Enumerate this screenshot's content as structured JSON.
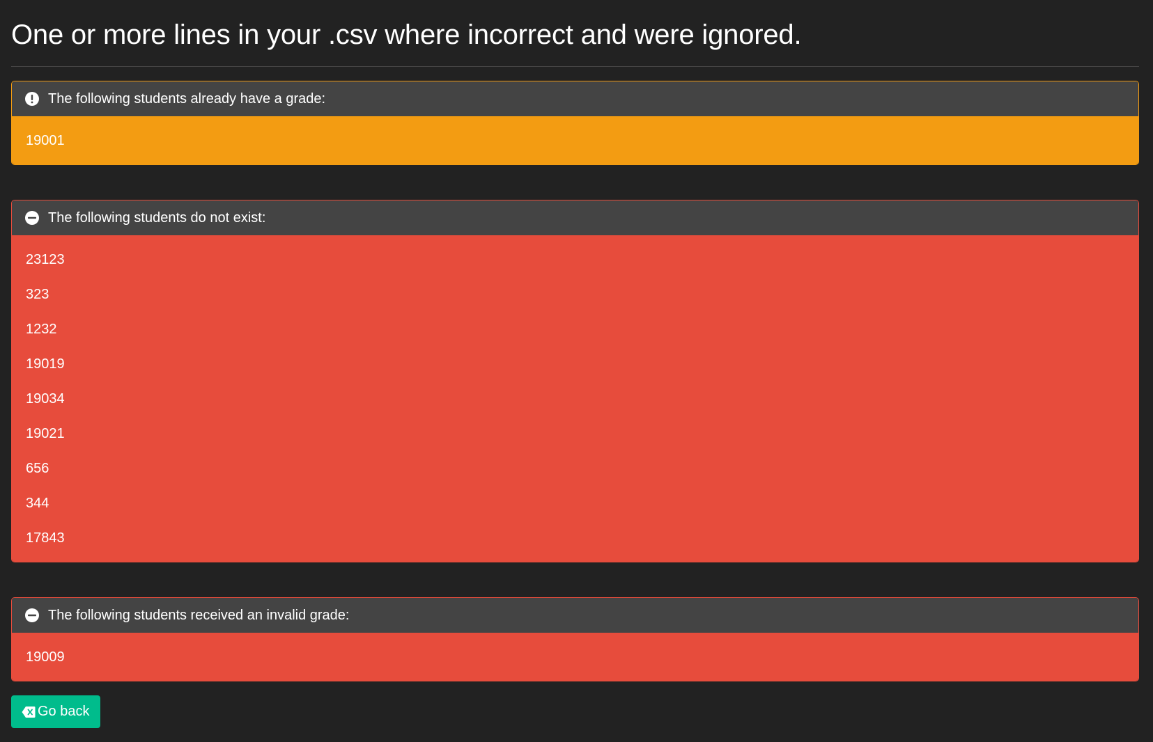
{
  "title": "One or more lines in your .csv where incorrect and were ignored.",
  "panels": {
    "already_graded": {
      "heading": "The following students already have a grade:",
      "icon": "exclamation-circle-icon",
      "color": "#f39c12",
      "items": [
        "19001"
      ]
    },
    "not_exist": {
      "heading": "The following students do not exist:",
      "icon": "minus-circle-icon",
      "color": "#e74c3c",
      "items": [
        "23123",
        "323",
        "1232",
        "19019",
        "19034",
        "19021",
        "656",
        "344",
        "17843"
      ]
    },
    "invalid_grade": {
      "heading": "The following students received an invalid grade:",
      "icon": "minus-circle-icon",
      "color": "#e74c3c",
      "items": [
        "19009"
      ]
    }
  },
  "back_button": {
    "label": "Go back",
    "icon": "backspace-icon",
    "color": "#00bc8c"
  },
  "colors": {
    "background": "#222222",
    "panel_heading": "#444444"
  }
}
